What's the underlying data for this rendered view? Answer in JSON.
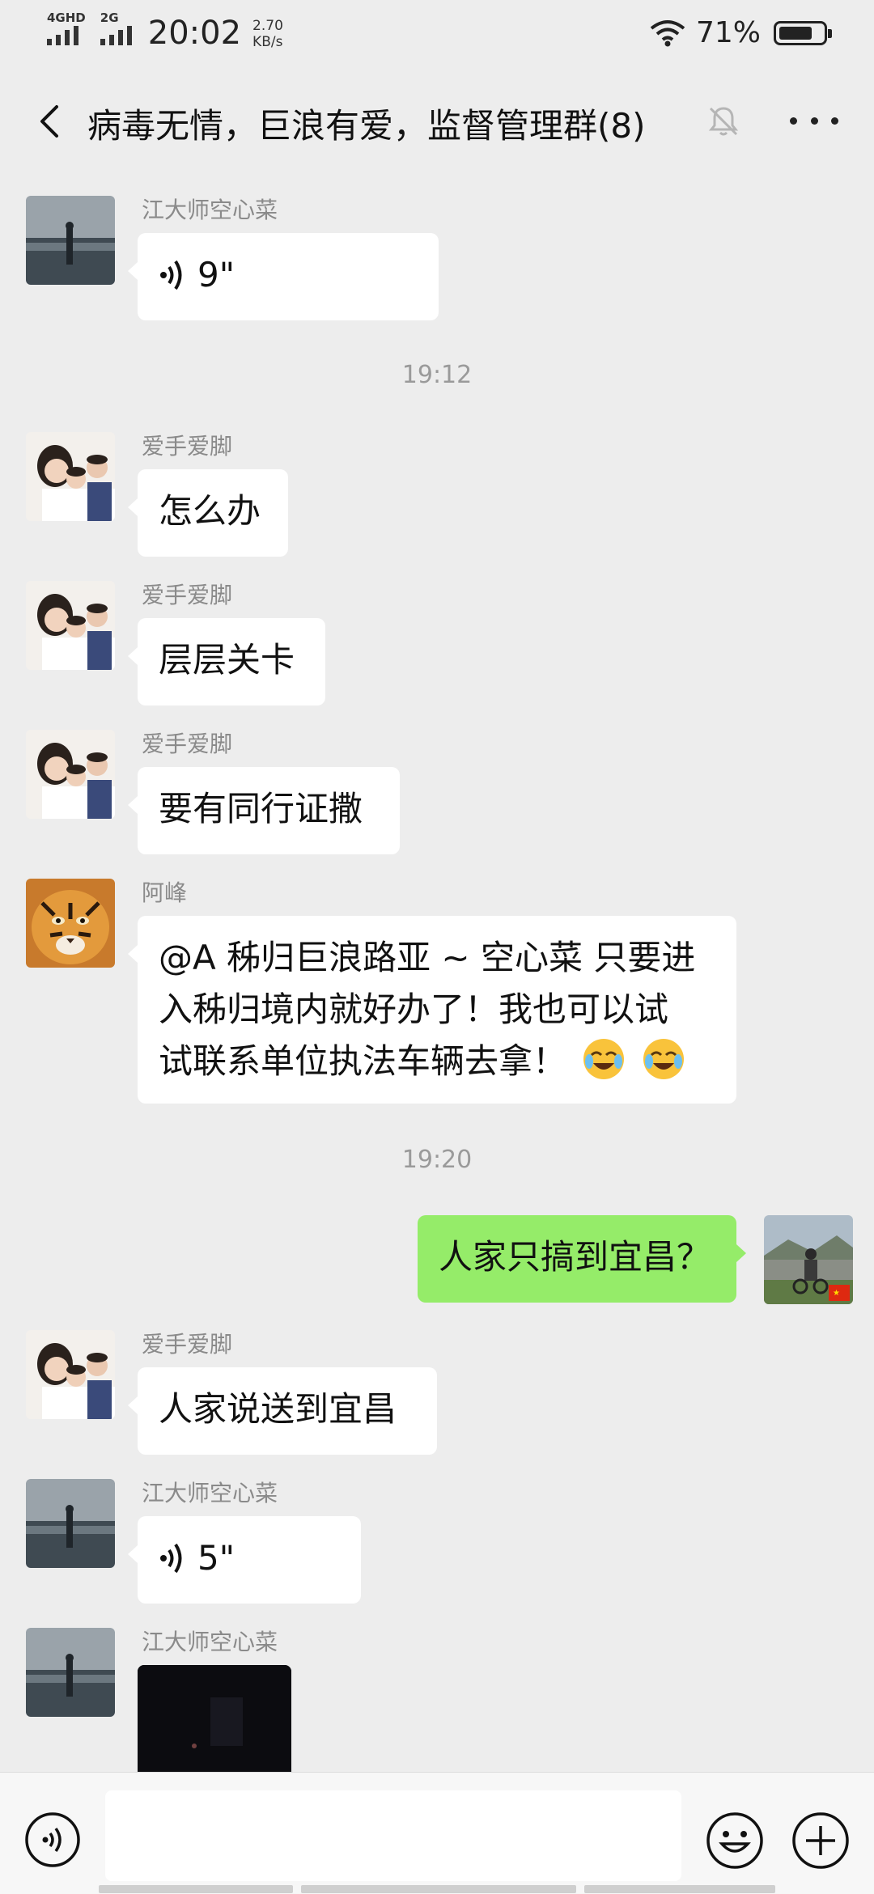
{
  "status_bar": {
    "network_primary": "4GHD",
    "network_secondary": "2G",
    "time": "20:02",
    "speed_value": "2.70",
    "speed_unit": "KB/s",
    "battery": "71%"
  },
  "header": {
    "title": "病毒无情，巨浪有爱，监督管理群(8)"
  },
  "messages": [
    {
      "sender": "江大师空心菜",
      "voice_duration": "9\""
    },
    {
      "timestamp": "19:12"
    },
    {
      "sender": "爱手爱脚",
      "text": "怎么办"
    },
    {
      "sender": "爱手爱脚",
      "text": "层层关卡"
    },
    {
      "sender": "爱手爱脚",
      "text": "要有同行证撒"
    },
    {
      "sender": "阿峰",
      "text_lines": [
        "@A 秭归巨浪路亚 ~ 空心菜  只要进",
        "入秭归境内就好办了！我也可以试",
        "试联系单位执法车辆去拿！"
      ],
      "emoji": "crying-laughing-emoji"
    },
    {
      "timestamp": "19:20"
    },
    {
      "self": true,
      "text": "人家只搞到宜昌？"
    },
    {
      "sender": "爱手爱脚",
      "text": "人家说送到宜昌"
    },
    {
      "sender": "江大师空心菜",
      "voice_duration": "5\""
    },
    {
      "sender": "江大师空心菜",
      "image": "night-photo"
    }
  ],
  "colors": {
    "background": "#ededed",
    "self_bubble": "#95ec69",
    "other_bubble": "#ffffff",
    "meta_text": "#8a8a8a"
  }
}
